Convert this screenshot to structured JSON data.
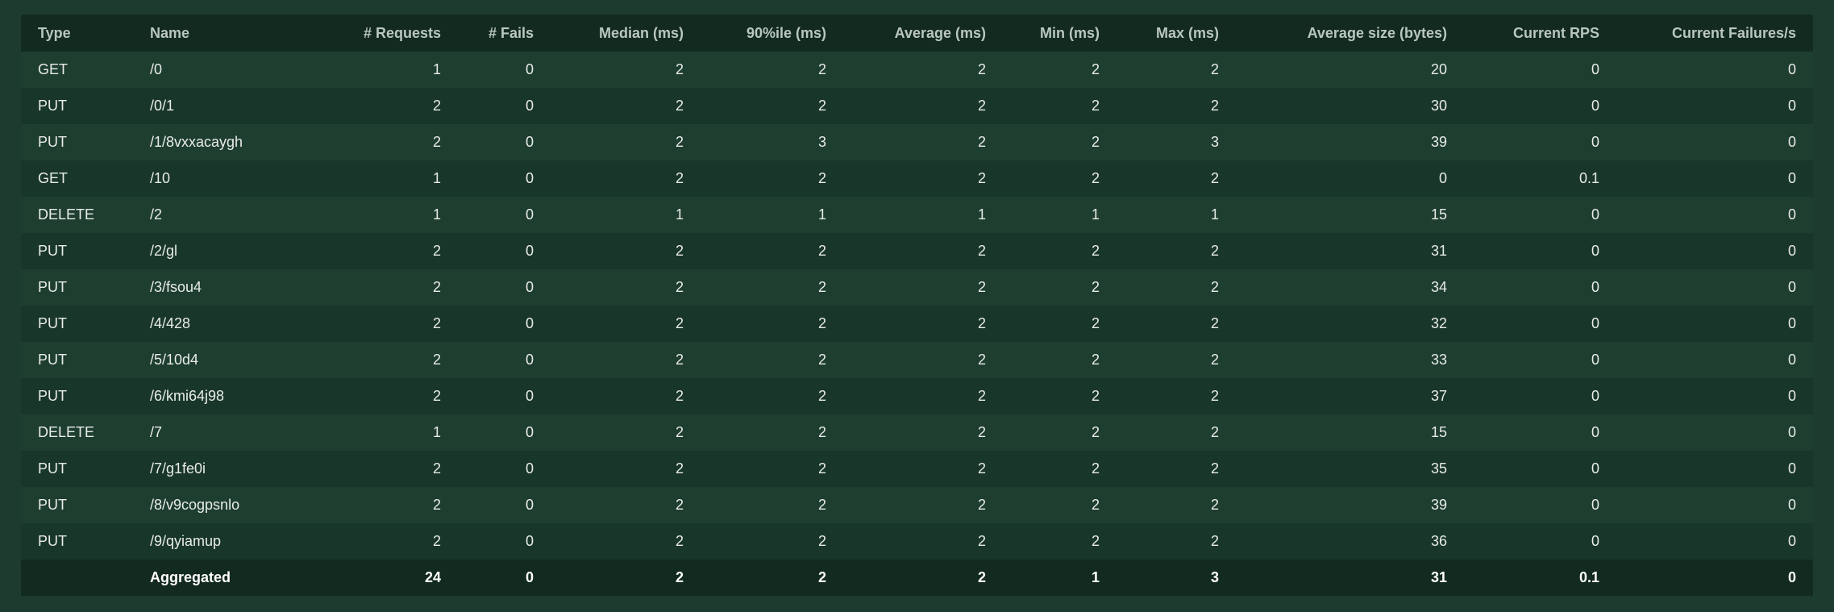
{
  "columns": [
    "Type",
    "Name",
    "# Requests",
    "# Fails",
    "Median (ms)",
    "90%ile (ms)",
    "Average (ms)",
    "Min (ms)",
    "Max (ms)",
    "Average size (bytes)",
    "Current RPS",
    "Current Failures/s"
  ],
  "rows": [
    [
      "GET",
      "/0",
      "1",
      "0",
      "2",
      "2",
      "2",
      "2",
      "2",
      "20",
      "0",
      "0"
    ],
    [
      "PUT",
      "/0/1",
      "2",
      "0",
      "2",
      "2",
      "2",
      "2",
      "2",
      "30",
      "0",
      "0"
    ],
    [
      "PUT",
      "/1/8vxxacaygh",
      "2",
      "0",
      "2",
      "3",
      "2",
      "2",
      "3",
      "39",
      "0",
      "0"
    ],
    [
      "GET",
      "/10",
      "1",
      "0",
      "2",
      "2",
      "2",
      "2",
      "2",
      "0",
      "0.1",
      "0"
    ],
    [
      "DELETE",
      "/2",
      "1",
      "0",
      "1",
      "1",
      "1",
      "1",
      "1",
      "15",
      "0",
      "0"
    ],
    [
      "PUT",
      "/2/gl",
      "2",
      "0",
      "2",
      "2",
      "2",
      "2",
      "2",
      "31",
      "0",
      "0"
    ],
    [
      "PUT",
      "/3/fsou4",
      "2",
      "0",
      "2",
      "2",
      "2",
      "2",
      "2",
      "34",
      "0",
      "0"
    ],
    [
      "PUT",
      "/4/428",
      "2",
      "0",
      "2",
      "2",
      "2",
      "2",
      "2",
      "32",
      "0",
      "0"
    ],
    [
      "PUT",
      "/5/10d4",
      "2",
      "0",
      "2",
      "2",
      "2",
      "2",
      "2",
      "33",
      "0",
      "0"
    ],
    [
      "PUT",
      "/6/kmi64j98",
      "2",
      "0",
      "2",
      "2",
      "2",
      "2",
      "2",
      "37",
      "0",
      "0"
    ],
    [
      "DELETE",
      "/7",
      "1",
      "0",
      "2",
      "2",
      "2",
      "2",
      "2",
      "15",
      "0",
      "0"
    ],
    [
      "PUT",
      "/7/g1fe0i",
      "2",
      "0",
      "2",
      "2",
      "2",
      "2",
      "2",
      "35",
      "0",
      "0"
    ],
    [
      "PUT",
      "/8/v9cogpsnlo",
      "2",
      "0",
      "2",
      "2",
      "2",
      "2",
      "2",
      "39",
      "0",
      "0"
    ],
    [
      "PUT",
      "/9/qyiamup",
      "2",
      "0",
      "2",
      "2",
      "2",
      "2",
      "2",
      "36",
      "0",
      "0"
    ]
  ],
  "aggregate": [
    "",
    "Aggregated",
    "24",
    "0",
    "2",
    "2",
    "2",
    "1",
    "3",
    "31",
    "0.1",
    "0"
  ],
  "colors": {
    "page_background": "#1d3c2f",
    "header_background": "#122a1f",
    "row_odd": "#1e3e2f",
    "row_even": "#19362a",
    "header_text": "#b9c7bf",
    "cell_text": "#e8ece9"
  }
}
